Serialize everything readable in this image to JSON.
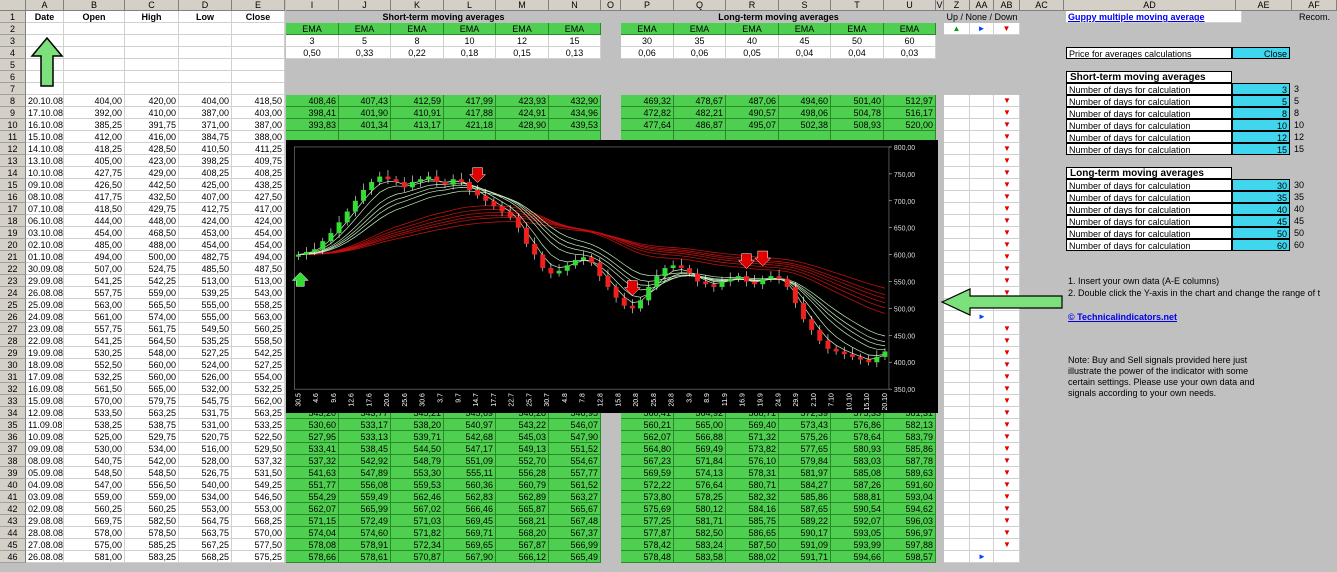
{
  "column_headers": [
    "A",
    "B",
    "C",
    "D",
    "E",
    "I",
    "J",
    "K",
    "L",
    "M",
    "N",
    "O",
    "P",
    "Q",
    "R",
    "S",
    "T",
    "U",
    "V",
    "Z",
    "AA",
    "AB",
    "AC",
    "AD",
    "AE",
    "AF"
  ],
  "row_headers": [
    "1",
    "2",
    "3",
    "4",
    "5",
    "6",
    "7",
    "8",
    "9",
    "10",
    "11",
    "12",
    "13",
    "14",
    "15",
    "16",
    "17",
    "18",
    "19",
    "20",
    "21",
    "22",
    "23",
    "24",
    "25",
    "26",
    "27",
    "28",
    "29",
    "30",
    "31",
    "32",
    "33",
    "34",
    "35",
    "36",
    "37",
    "38",
    "39",
    "40",
    "41",
    "42",
    "43",
    "44",
    "45",
    "46"
  ],
  "header_row": {
    "date": "Date",
    "open": "Open",
    "high": "High",
    "low": "Low",
    "close": "Close"
  },
  "short_title": "Short-term moving averages",
  "long_title": "Long-term moving averages",
  "signals_header": "Up / None / Down",
  "recom_header": "Recom.",
  "ema_label": "EMA",
  "short_days": [
    "3",
    "5",
    "8",
    "10",
    "12",
    "15"
  ],
  "short_alpha": [
    "0,50",
    "0,33",
    "0,22",
    "0,18",
    "0,15",
    "0,13"
  ],
  "long_days": [
    "30",
    "35",
    "40",
    "45",
    "50",
    "60"
  ],
  "long_alpha": [
    "0,06",
    "0,06",
    "0,05",
    "0,04",
    "0,04",
    "0,03"
  ],
  "legend_signals": {
    "up": "▲",
    "none": "►",
    "down": "▼"
  },
  "rows": [
    {
      "date": "20.10.08",
      "open": "404,00",
      "high": "420,00",
      "low": "404,00",
      "close": "418,50",
      "s": [
        "408,46",
        "407,43",
        "412,59",
        "417,99",
        "423,93",
        "432,90"
      ],
      "l": [
        "469,32",
        "478,67",
        "487,06",
        "494,60",
        "501,40",
        "512,97"
      ],
      "sig": "down"
    },
    {
      "date": "17.10.08",
      "open": "392,00",
      "high": "410,00",
      "low": "387,00",
      "close": "403,00",
      "s": [
        "398,41",
        "401,90",
        "410,91",
        "417,88",
        "424,91",
        "434,96"
      ],
      "l": [
        "472,82",
        "482,21",
        "490,57",
        "498,06",
        "504,78",
        "516,17"
      ],
      "sig": "down"
    },
    {
      "date": "16.10.08",
      "open": "385,25",
      "high": "391,75",
      "low": "371,00",
      "close": "387,00",
      "s": [
        "393,83",
        "401,34",
        "413,17",
        "421,18",
        "428,90",
        "439,53"
      ],
      "l": [
        "477,64",
        "486,87",
        "495,07",
        "502,38",
        "508,93",
        "520,00"
      ],
      "sig": "down"
    },
    {
      "date": "15.10.08",
      "open": "412,00",
      "high": "416,00",
      "low": "384,75",
      "close": "388,00",
      "s": [],
      "l": [],
      "sig": "down"
    },
    {
      "date": "14.10.08",
      "open": "418,25",
      "high": "428,50",
      "low": "410,50",
      "close": "411,25",
      "s": [],
      "l": [],
      "sig": "down"
    },
    {
      "date": "13.10.08",
      "open": "405,00",
      "high": "423,00",
      "low": "398,25",
      "close": "409,75",
      "s": [],
      "l": [],
      "sig": "down"
    },
    {
      "date": "10.10.08",
      "open": "427,75",
      "high": "429,00",
      "low": "408,25",
      "close": "408,25",
      "s": [],
      "l": [],
      "sig": "down"
    },
    {
      "date": "09.10.08",
      "open": "426,50",
      "high": "442,50",
      "low": "425,00",
      "close": "438,25",
      "s": [],
      "l": [],
      "sig": "down"
    },
    {
      "date": "08.10.08",
      "open": "417,75",
      "high": "432,50",
      "low": "407,00",
      "close": "427,50",
      "s": [],
      "l": [],
      "sig": "down"
    },
    {
      "date": "07.10.08",
      "open": "418,50",
      "high": "429,75",
      "low": "412,75",
      "close": "417,00",
      "s": [],
      "l": [],
      "sig": "down"
    },
    {
      "date": "06.10.08",
      "open": "444,00",
      "high": "448,00",
      "low": "424,00",
      "close": "424,00",
      "s": [],
      "l": [],
      "sig": "down"
    },
    {
      "date": "03.10.08",
      "open": "454,00",
      "high": "468,50",
      "low": "453,00",
      "close": "454,00",
      "s": [],
      "l": [],
      "sig": "down"
    },
    {
      "date": "02.10.08",
      "open": "485,00",
      "high": "488,00",
      "low": "454,00",
      "close": "454,00",
      "s": [],
      "l": [],
      "sig": "down"
    },
    {
      "date": "01.10.08",
      "open": "494,00",
      "high": "500,00",
      "low": "482,75",
      "close": "494,00",
      "s": [],
      "l": [],
      "sig": "down"
    },
    {
      "date": "30.09.08",
      "open": "507,00",
      "high": "524,75",
      "low": "485,50",
      "close": "487,50",
      "s": [],
      "l": [],
      "sig": "down"
    },
    {
      "date": "29.09.08",
      "open": "541,25",
      "high": "542,25",
      "low": "513,00",
      "close": "513,00",
      "s": [],
      "l": [],
      "sig": "down"
    },
    {
      "date": "26.08.08",
      "open": "557,75",
      "high": "559,00",
      "low": "539,25",
      "close": "543,00",
      "s": [],
      "l": [],
      "sig": "down"
    },
    {
      "date": "25.09.08",
      "open": "563,00",
      "high": "565,50",
      "low": "555,00",
      "close": "558,25",
      "s": [],
      "l": [],
      "sig": "none"
    },
    {
      "date": "24.09.08",
      "open": "561,00",
      "high": "574,00",
      "low": "555,00",
      "close": "563,00",
      "s": [],
      "l": [],
      "sig": "none"
    },
    {
      "date": "23.09.08",
      "open": "557,75",
      "high": "561,75",
      "low": "549,50",
      "close": "560,25",
      "s": [],
      "l": [],
      "sig": "down"
    },
    {
      "date": "22.09.08",
      "open": "541,25",
      "high": "564,50",
      "low": "535,25",
      "close": "558,50",
      "s": [],
      "l": [],
      "sig": "down"
    },
    {
      "date": "19.09.08",
      "open": "530,25",
      "high": "548,00",
      "low": "527,25",
      "close": "542,25",
      "s": [],
      "l": [],
      "sig": "down"
    },
    {
      "date": "18.09.08",
      "open": "552,50",
      "high": "560,00",
      "low": "524,00",
      "close": "527,25",
      "s": [],
      "l": [],
      "sig": "down"
    },
    {
      "date": "17.09.08",
      "open": "532,25",
      "high": "560,00",
      "low": "526,00",
      "close": "554,00",
      "s": [],
      "l": [],
      "sig": "down"
    },
    {
      "date": "16.09.08",
      "open": "561,50",
      "high": "565,00",
      "low": "532,00",
      "close": "532,25",
      "s": [],
      "l": [],
      "sig": "down"
    },
    {
      "date": "15.09.08",
      "open": "570,00",
      "high": "579,75",
      "low": "545,75",
      "close": "562,00",
      "s": [],
      "l": [],
      "sig": "down"
    },
    {
      "date": "12.09.08",
      "open": "533,50",
      "high": "563,25",
      "low": "531,75",
      "close": "563,25",
      "s": [
        "543,20",
        "543,77",
        "545,21",
        "545,69",
        "546,28",
        "546,95"
      ],
      "l": [
        "560,41",
        "564,92",
        "568,71",
        "572,39",
        "575,33",
        "581,31"
      ],
      "sig": "down"
    },
    {
      "date": "11.09.08",
      "open": "538,25",
      "high": "538,75",
      "low": "531,00",
      "close": "533,25",
      "s": [
        "530,60",
        "533,17",
        "538,20",
        "540,97",
        "543,22",
        "546,07"
      ],
      "l": [
        "560,21",
        "565,00",
        "569,40",
        "573,43",
        "576,86",
        "582,13"
      ],
      "sig": "down"
    },
    {
      "date": "10.09.08",
      "open": "525,00",
      "high": "529,75",
      "low": "520,75",
      "close": "522,50",
      "s": [
        "527,95",
        "533,13",
        "539,71",
        "542,68",
        "545,03",
        "547,90"
      ],
      "l": [
        "562,07",
        "566,88",
        "571,32",
        "575,26",
        "578,64",
        "583,79"
      ],
      "sig": "down"
    },
    {
      "date": "09.09.08",
      "open": "530,00",
      "high": "534,00",
      "low": "516,00",
      "close": "529,50",
      "s": [
        "533,41",
        "538,45",
        "544,50",
        "547,17",
        "549,13",
        "551,52"
      ],
      "l": [
        "564,80",
        "569,49",
        "573,82",
        "577,65",
        "580,93",
        "585,86"
      ],
      "sig": "down"
    },
    {
      "date": "08.09.08",
      "open": "540,75",
      "high": "542,00",
      "low": "528,00",
      "close": "537,32",
      "s": [
        "537,32",
        "542,92",
        "548,79",
        "551,09",
        "552,70",
        "554,67"
      ],
      "l": [
        "567,23",
        "571,84",
        "576,10",
        "579,84",
        "583,03",
        "587,78"
      ],
      "sig": "down"
    },
    {
      "date": "05.09.08",
      "open": "548,50",
      "high": "548,50",
      "low": "526,75",
      "close": "531,50",
      "s": [
        "541,63",
        "547,89",
        "553,30",
        "555,11",
        "556,28",
        "557,77"
      ],
      "l": [
        "569,59",
        "574,13",
        "578,31",
        "581,97",
        "585,08",
        "589,63"
      ],
      "sig": "down"
    },
    {
      "date": "04.09.08",
      "open": "547,00",
      "high": "556,50",
      "low": "540,00",
      "close": "549,25",
      "s": [
        "551,77",
        "556,08",
        "559,53",
        "560,36",
        "560,79",
        "561,52"
      ],
      "l": [
        "572,22",
        "576,64",
        "580,71",
        "584,27",
        "587,26",
        "591,60"
      ],
      "sig": "down"
    },
    {
      "date": "03.09.08",
      "open": "559,00",
      "high": "559,00",
      "low": "534,00",
      "close": "546,50",
      "s": [
        "554,29",
        "559,49",
        "562,46",
        "562,83",
        "562,89",
        "563,27"
      ],
      "l": [
        "573,80",
        "578,25",
        "582,32",
        "585,86",
        "588,81",
        "593,04"
      ],
      "sig": "down"
    },
    {
      "date": "02.09.08",
      "open": "560,25",
      "high": "560,25",
      "low": "553,00",
      "close": "553,00",
      "s": [
        "562,07",
        "565,99",
        "567,02",
        "566,46",
        "565,87",
        "565,67"
      ],
      "l": [
        "575,69",
        "580,12",
        "584,16",
        "587,65",
        "590,54",
        "594,62"
      ],
      "sig": "down"
    },
    {
      "date": "29.08.08",
      "open": "569,75",
      "high": "582,50",
      "low": "564,75",
      "close": "568,25",
      "s": [
        "571,15",
        "572,49",
        "571,03",
        "569,45",
        "568,21",
        "567,48"
      ],
      "l": [
        "577,25",
        "581,71",
        "585,75",
        "589,22",
        "592,07",
        "596,03"
      ],
      "sig": "down"
    },
    {
      "date": "28.08.08",
      "open": "578,00",
      "high": "578,50",
      "low": "563,75",
      "close": "570,00",
      "s": [
        "574,04",
        "574,60",
        "571,82",
        "569,71",
        "568,20",
        "567,37"
      ],
      "l": [
        "577,87",
        "582,50",
        "586,65",
        "590,17",
        "593,05",
        "596,97"
      ],
      "sig": "down"
    },
    {
      "date": "27.08.08",
      "open": "575,00",
      "high": "585,25",
      "low": "567,25",
      "close": "577,50",
      "s": [
        "578,08",
        "578,91",
        "572,34",
        "569,65",
        "567,87",
        "566,99"
      ],
      "l": [
        "578,42",
        "583,24",
        "587,50",
        "591,09",
        "593,99",
        "597,88"
      ],
      "sig": "down"
    },
    {
      "date": "26.08.08",
      "open": "581,00",
      "high": "583,25",
      "low": "568,25",
      "close": "575,25",
      "s": [
        "578,66",
        "578,61",
        "570,87",
        "567,90",
        "566,12",
        "565,49"
      ],
      "l": [
        "578,48",
        "583,58",
        "588,02",
        "591,71",
        "594,66",
        "598,57"
      ],
      "sig": "right"
    }
  ],
  "right_panel": {
    "title_link": "Guppy multiple moving average",
    "price_label": "Price for averages calculations",
    "price_value": "Close",
    "short_box_title": "Short-term moving averages",
    "long_box_title": "Long-term moving averages",
    "days_label": "Number of days for calculation",
    "short_values": [
      "3",
      "5",
      "8",
      "10",
      "12",
      "15"
    ],
    "long_values": [
      "30",
      "35",
      "40",
      "45",
      "50",
      "60"
    ],
    "instruction1": "1. Insert your own data (A-E columns)",
    "instruction2": "2. Double click the Y-axis in the chart and change the range of t",
    "site_link": "© Technicalindicators.net",
    "note": "Note: Buy and Sell signals provided here just illustrate the power of the indicator with some certain settings. Please use your own data and signals according to your own needs."
  },
  "colors": {
    "green_cell": "#4fcf4f",
    "cyan_input": "#3fd6ee",
    "chart_bg": "#000000",
    "candle_up": "#33dd33",
    "candle_down": "#ee2020",
    "short_ema": "#c8f0c0",
    "long_ema": "#c01010",
    "arrow_green": "#7ce07c",
    "signal_red": "#e00000"
  },
  "chart_data": {
    "type": "candlestick",
    "ylim": [
      350,
      800
    ],
    "yticks": [
      "800,00",
      "750,00",
      "700,00",
      "650,00",
      "600,00",
      "550,00",
      "500,00",
      "450,00",
      "400,00",
      "350,00"
    ],
    "xticks": [
      "30.5",
      "4.6",
      "9.6",
      "12.6",
      "17.6",
      "20.6",
      "25.6",
      "30.6",
      "3.7",
      "9.7",
      "14.7",
      "17.7",
      "22.7",
      "25.7",
      "30.7",
      "4.8",
      "7.8",
      "12.8",
      "15.8",
      "20.8",
      "25.8",
      "28.8",
      "3.9",
      "8.9",
      "11.9",
      "16.9",
      "19.9",
      "24.9",
      "29.9",
      "2.10",
      "7.10",
      "10.10",
      "15.10",
      "20.10"
    ],
    "close": [
      600,
      605,
      610,
      625,
      640,
      660,
      680,
      700,
      720,
      735,
      745,
      740,
      735,
      725,
      735,
      740,
      745,
      735,
      730,
      740,
      735,
      720,
      710,
      700,
      690,
      680,
      670,
      650,
      620,
      600,
      575,
      565,
      570,
      580,
      590,
      595,
      585,
      560,
      540,
      520,
      505,
      500,
      515,
      540,
      560,
      575,
      580,
      575,
      565,
      550,
      545,
      540,
      550,
      555,
      560,
      550,
      545,
      555,
      560,
      555,
      540,
      510,
      480,
      460,
      440,
      425,
      420,
      415,
      410,
      405,
      400,
      410,
      420
    ],
    "arrows_down_at": [
      22,
      41,
      55,
      57
    ],
    "arrow_up_at": 0
  }
}
